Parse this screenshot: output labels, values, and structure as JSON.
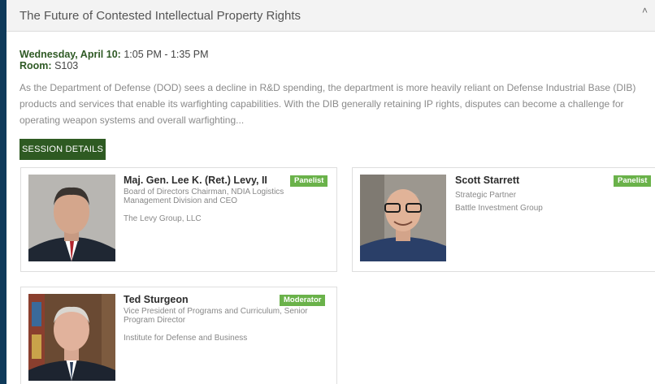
{
  "session": {
    "title": "The Future of Contested Intellectual Property Rights",
    "date_label": "Wednesday, April 10",
    "time": "1:05 PM - 1:35 PM",
    "room_label": "Room:",
    "room": "S103",
    "description": "As the Department of Defense (DOD) sees a decline in R&D spending, the department is more heavily reliant on Defense Industrial Base (DIB) products and services that enable its warfighting capabilities. With the DIB generally retaining IP rights, disputes can become a challenge for operating weapon systems and overall warfighting...",
    "details_button": "SESSION DETAILS"
  },
  "speakers": [
    {
      "name": "Maj. Gen. Lee K. (Ret.) Levy, II",
      "role": "Panelist",
      "title": "Board of Directors Chairman, NDIA Logistics Management Division and CEO",
      "org": "The Levy Group, LLC"
    },
    {
      "name": "Scott Starrett",
      "role": "Panelist",
      "title": "Strategic Partner",
      "org": "Battle Investment Group"
    },
    {
      "name": "Ted Sturgeon",
      "role": "Moderator",
      "title": "Vice President of Programs and Curriculum, Senior Program Director",
      "org": "Institute for Defense and Business"
    }
  ],
  "colors": {
    "frame": "#0f3a5a",
    "button": "#2e5a22",
    "badge": "#6ab24a"
  }
}
